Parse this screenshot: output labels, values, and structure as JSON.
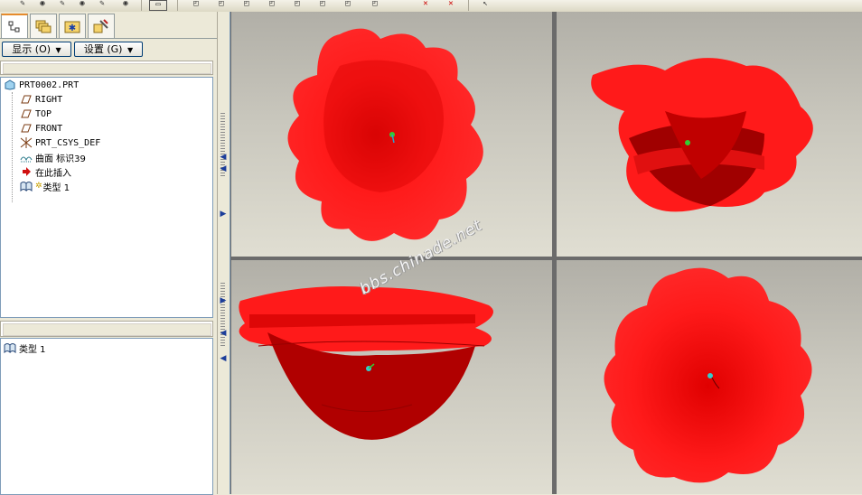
{
  "toolbar": {
    "buttons": [
      "✎",
      "◉",
      "✎",
      "◉",
      "✎",
      "◉",
      "▭",
      "◰",
      "◰",
      "◰",
      "◰",
      "◰",
      "◰",
      "◰",
      "◰",
      "✕",
      "✕",
      "↖"
    ]
  },
  "panel_tabs": [
    {
      "name": "model-tree-tab",
      "icon": "tree-icon"
    },
    {
      "name": "folder-browser-tab",
      "icon": "folders-icon"
    },
    {
      "name": "favorites-tab",
      "icon": "favorites-icon"
    },
    {
      "name": "connections-tab",
      "icon": "tools-icon"
    }
  ],
  "buttons": {
    "show": "显示",
    "show_key": "(O)",
    "settings": "设置",
    "settings_key": "(G)"
  },
  "model_tree": {
    "root": "PRT0002.PRT",
    "items": [
      {
        "label": "RIGHT",
        "icon": "datum-plane-icon",
        "mono": true
      },
      {
        "label": "TOP",
        "icon": "datum-plane-icon",
        "mono": true
      },
      {
        "label": "FRONT",
        "icon": "datum-plane-icon",
        "mono": true
      },
      {
        "label": "PRT_CSYS_DEF",
        "icon": "csys-icon",
        "mono": true
      },
      {
        "label": "曲面 标识39",
        "icon": "surface-icon",
        "mono": false
      },
      {
        "label": "在此插入",
        "icon": "insert-here-icon",
        "mono": false
      },
      {
        "label": "类型 1",
        "icon": "feature-type-icon",
        "mono": false
      }
    ]
  },
  "lower_list": {
    "items": [
      {
        "label": "类型 1",
        "icon": "feature-type-icon"
      }
    ]
  },
  "watermark": "bbs.chinade.net",
  "colors": {
    "model_red": "#ff1010",
    "model_dark": "#a00000",
    "accent_tab": "#e68b2c"
  }
}
